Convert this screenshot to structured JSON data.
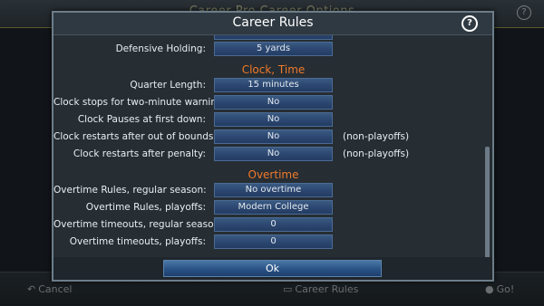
{
  "background": {
    "title": "Career Pro Career Options",
    "help_glyph": "?",
    "cancel_label": "Cancel",
    "center_label": "Career Rules",
    "go_label": "Go!"
  },
  "dialog": {
    "title": "Career Rules",
    "help_glyph": "?",
    "ok_label": "Ok",
    "rows": [
      {
        "label": "Defensive Holding:",
        "value": "5 yards"
      },
      {
        "label": "Quarter Length:",
        "value": "15 minutes"
      },
      {
        "label": "Clock stops for two-minute warning:",
        "value": "No"
      },
      {
        "label": "Clock Pauses at first down:",
        "value": "No"
      },
      {
        "label": "Clock restarts after out of bounds:",
        "value": "No",
        "note": "(non-playoffs)"
      },
      {
        "label": "Clock restarts after penalty:",
        "value": "No",
        "note": "(non-playoffs)"
      },
      {
        "label": "Overtime Rules, regular season:",
        "value": "No overtime"
      },
      {
        "label": "Overtime Rules, playoffs:",
        "value": "Modern College"
      },
      {
        "label": "Overtime timeouts, regular season:",
        "value": "0"
      },
      {
        "label": "Overtime timeouts, playoffs:",
        "value": "0"
      }
    ],
    "sections": {
      "clock": "Clock, Time",
      "overtime": "Overtime"
    }
  },
  "colors": {
    "section_heading": "#f07a2a",
    "value_button": "#2b4670",
    "dialog_bg": "#262d33"
  }
}
